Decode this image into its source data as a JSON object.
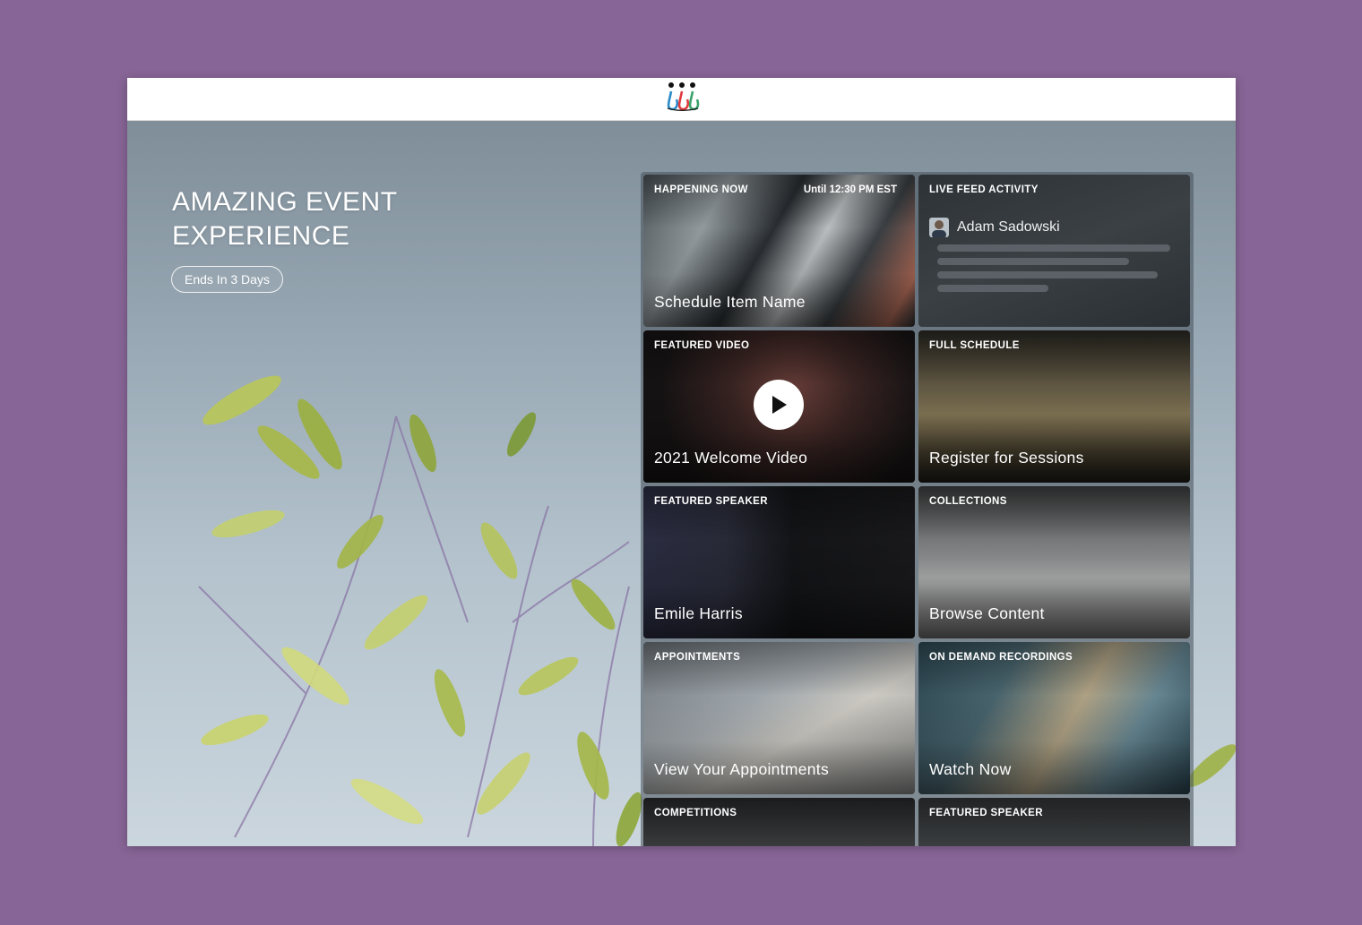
{
  "hero": {
    "title": "AMAZING EVENT EXPERIENCE",
    "ends_badge": "Ends In 3 Days"
  },
  "tiles": [
    {
      "label": "HAPPENING NOW",
      "meta": "Until 12:30 PM EST",
      "name": "Schedule Item Name"
    },
    {
      "label": "LIVE FEED ACTIVITY",
      "user": "Adam Sadowski"
    },
    {
      "label": "FEATURED VIDEO",
      "name": "2021 Welcome Video"
    },
    {
      "label": "FULL SCHEDULE",
      "name": "Register for Sessions"
    },
    {
      "label": "FEATURED SPEAKER",
      "name": "Emile Harris"
    },
    {
      "label": "COLLECTIONS",
      "name": "Browse Content"
    },
    {
      "label": "APPOINTMENTS",
      "name": "View Your Appointments"
    },
    {
      "label": "ON DEMAND RECORDINGS",
      "name": "Watch Now"
    },
    {
      "label": "COMPETITIONS"
    },
    {
      "label": "FEATURED SPEAKER"
    }
  ],
  "colors": {
    "page_background": "#876596",
    "logo_blue": "#2a8bc9",
    "logo_red": "#e03a3e",
    "logo_green": "#3aa36b"
  }
}
